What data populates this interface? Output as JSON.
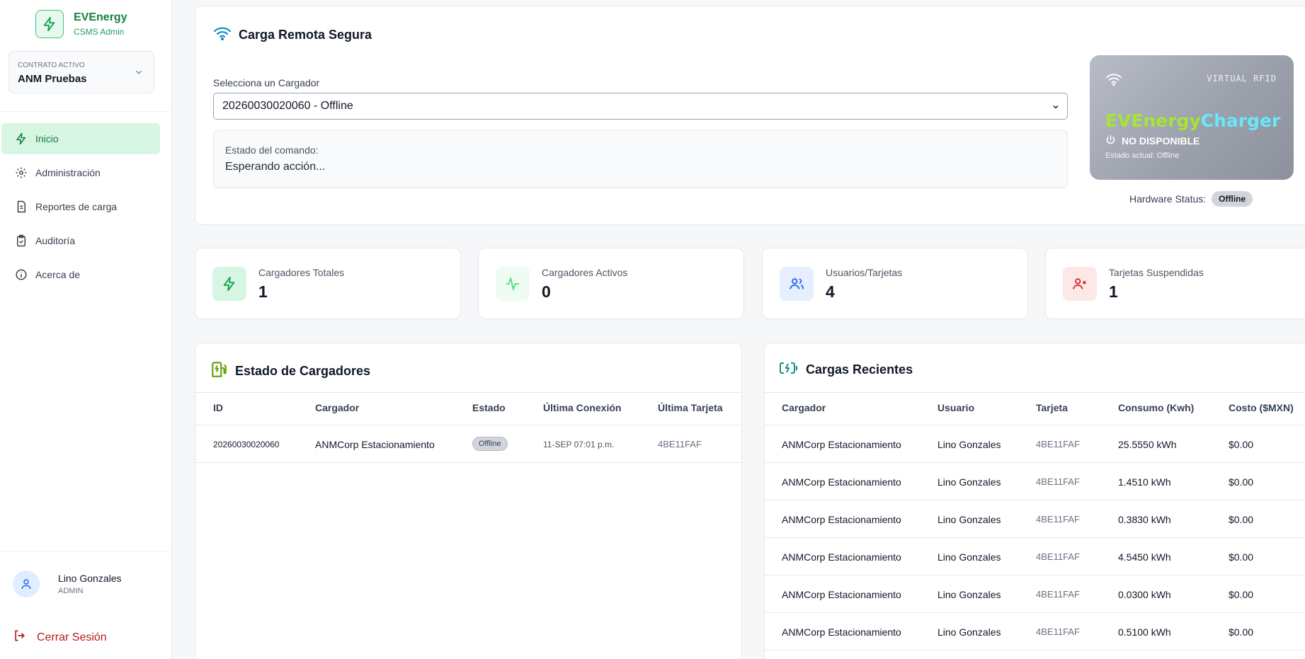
{
  "brand": {
    "name": "EVEnergy",
    "sub": "CSMS Admin"
  },
  "contract": {
    "label": "CONTRATO ACTIVO",
    "value": "ANM Pruebas"
  },
  "nav": [
    {
      "label": "Inicio",
      "icon": "bolt-icon",
      "active": true
    },
    {
      "label": "Administración",
      "icon": "gear-icon"
    },
    {
      "label": "Reportes de carga",
      "icon": "report-icon"
    },
    {
      "label": "Auditoría",
      "icon": "clipboard-check-icon"
    },
    {
      "label": "Acerca de",
      "icon": "info-icon"
    }
  ],
  "user": {
    "name": "Lino Gonzales",
    "role": "ADMIN",
    "logout": "Cerrar Sesión"
  },
  "remote": {
    "title": "Carga Remota Segura",
    "select_label": "Selecciona un Cargador",
    "select_value": "20260030020060 - Offline",
    "cmd_label": "Estado del comando:",
    "cmd_value": "Esperando acción..."
  },
  "rfid": {
    "tag": "VIRTUAL RFID",
    "brand_a": "EVEnergy",
    "brand_b": "Charger",
    "status": "NO DISPONIBLE",
    "state": "Estado actual: Offline",
    "hw_label": "Hardware Status:",
    "hw_value": "Offline"
  },
  "stats": [
    {
      "label": "Cargadores Totales",
      "value": "1",
      "color": "#16a34a",
      "bg": "#d6f5e3"
    },
    {
      "label": "Cargadores Activos",
      "value": "0",
      "color": "#4ade80",
      "bg": "#eefcf3"
    },
    {
      "label": "Usuarios/Tarjetas",
      "value": "4",
      "color": "#2563eb",
      "bg": "#e6efff"
    },
    {
      "label": "Tarjetas Suspendidas",
      "value": "1",
      "color": "#dc2626",
      "bg": "#fde8e8"
    }
  ],
  "chargers": {
    "title": "Estado de Cargadores",
    "columns": [
      "ID",
      "Cargador",
      "Estado",
      "Última Conexión",
      "Última Tarjeta"
    ],
    "rows": [
      {
        "id": "20260030020060",
        "name": "ANMCorp Estacionamiento",
        "status": "Offline",
        "last": "11-SEP 07:01 p.m.",
        "card": "4BE11FAF"
      }
    ]
  },
  "recent": {
    "title": "Cargas Recientes",
    "columns": [
      "Cargador",
      "Usuario",
      "Tarjeta",
      "Consumo (Kwh)",
      "Costo ($MXN)"
    ],
    "rows": [
      {
        "charger": "ANMCorp Estacionamiento",
        "user": "Lino Gonzales",
        "card": "4BE11FAF",
        "kwh": "25.5550 kWh",
        "cost": "$0.00"
      },
      {
        "charger": "ANMCorp Estacionamiento",
        "user": "Lino Gonzales",
        "card": "4BE11FAF",
        "kwh": "1.4510 kWh",
        "cost": "$0.00"
      },
      {
        "charger": "ANMCorp Estacionamiento",
        "user": "Lino Gonzales",
        "card": "4BE11FAF",
        "kwh": "0.3830 kWh",
        "cost": "$0.00"
      },
      {
        "charger": "ANMCorp Estacionamiento",
        "user": "Lino Gonzales",
        "card": "4BE11FAF",
        "kwh": "4.5450 kWh",
        "cost": "$0.00"
      },
      {
        "charger": "ANMCorp Estacionamiento",
        "user": "Lino Gonzales",
        "card": "4BE11FAF",
        "kwh": "0.0300 kWh",
        "cost": "$0.00"
      },
      {
        "charger": "ANMCorp Estacionamiento",
        "user": "Lino Gonzales",
        "card": "4BE11FAF",
        "kwh": "0.5100 kWh",
        "cost": "$0.00"
      }
    ]
  }
}
